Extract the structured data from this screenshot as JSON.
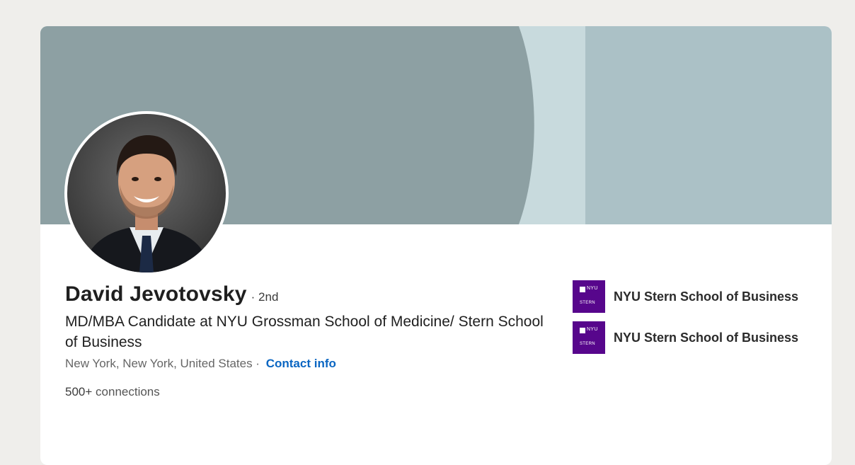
{
  "profile": {
    "name": "David Jevotovsky",
    "degree": "· 2nd",
    "headline": "MD/MBA Candidate at NYU Grossman School of Medicine/ Stern School of Business",
    "location": "New York, New York, United States ·",
    "contact_label": "Contact info",
    "connections_count": "500+",
    "connections_label": "connections"
  },
  "education": [
    {
      "school": "NYU Stern School of Business",
      "logo_top": "NYU",
      "logo_bottom": "STERN"
    },
    {
      "school": "NYU Stern School of Business",
      "logo_top": "NYU",
      "logo_bottom": "STERN"
    }
  ],
  "colors": {
    "banner_dark": "#8ea2a5",
    "banner_light": "#c7dade",
    "banner_right": "#abc1c6",
    "link": "#0a66c2",
    "logo_purple": "#57068c"
  },
  "icons": {
    "school_logo": "nyu-torch-icon"
  }
}
